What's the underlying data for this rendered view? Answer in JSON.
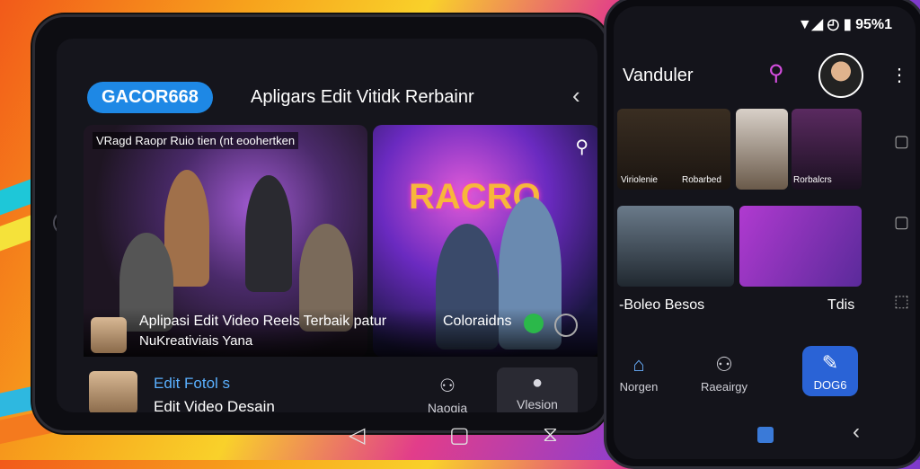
{
  "tablet": {
    "brand_label": "GACOR668",
    "app_title": "Apligars Edit Vitidk Rerbainr",
    "back_icon": "chevron-left-icon",
    "card1_caption": "VRagd Raopr Ruio tien  (nt eoohertken",
    "card2_neon": "RACRO",
    "overlay_title": "Aplipasi Edit Video Reels Terbaik patur",
    "overlay_subtitle": "NuKreativiais Yana",
    "overlay_right": "Coloraidns",
    "bottom_line1": "Edit Fotol s",
    "bottom_line2": "Edit Video Desain",
    "nav_left_label": "Naogia",
    "nav_right_label": "Vlesion",
    "sys_nav": [
      "◁",
      "▢",
      "⧖"
    ]
  },
  "phone": {
    "status_text": "95%1",
    "title": "Vanduler",
    "search_icon": "search-icon",
    "cap1": "Viriolenie",
    "cap2": "Robarbed",
    "cap3": "Rorbalcrs",
    "section_left": "-Boleo Besos",
    "section_right": "Tdis",
    "nav_home": "Norgen",
    "nav_share": "Raeairgy",
    "nav_active": "DOG6"
  }
}
